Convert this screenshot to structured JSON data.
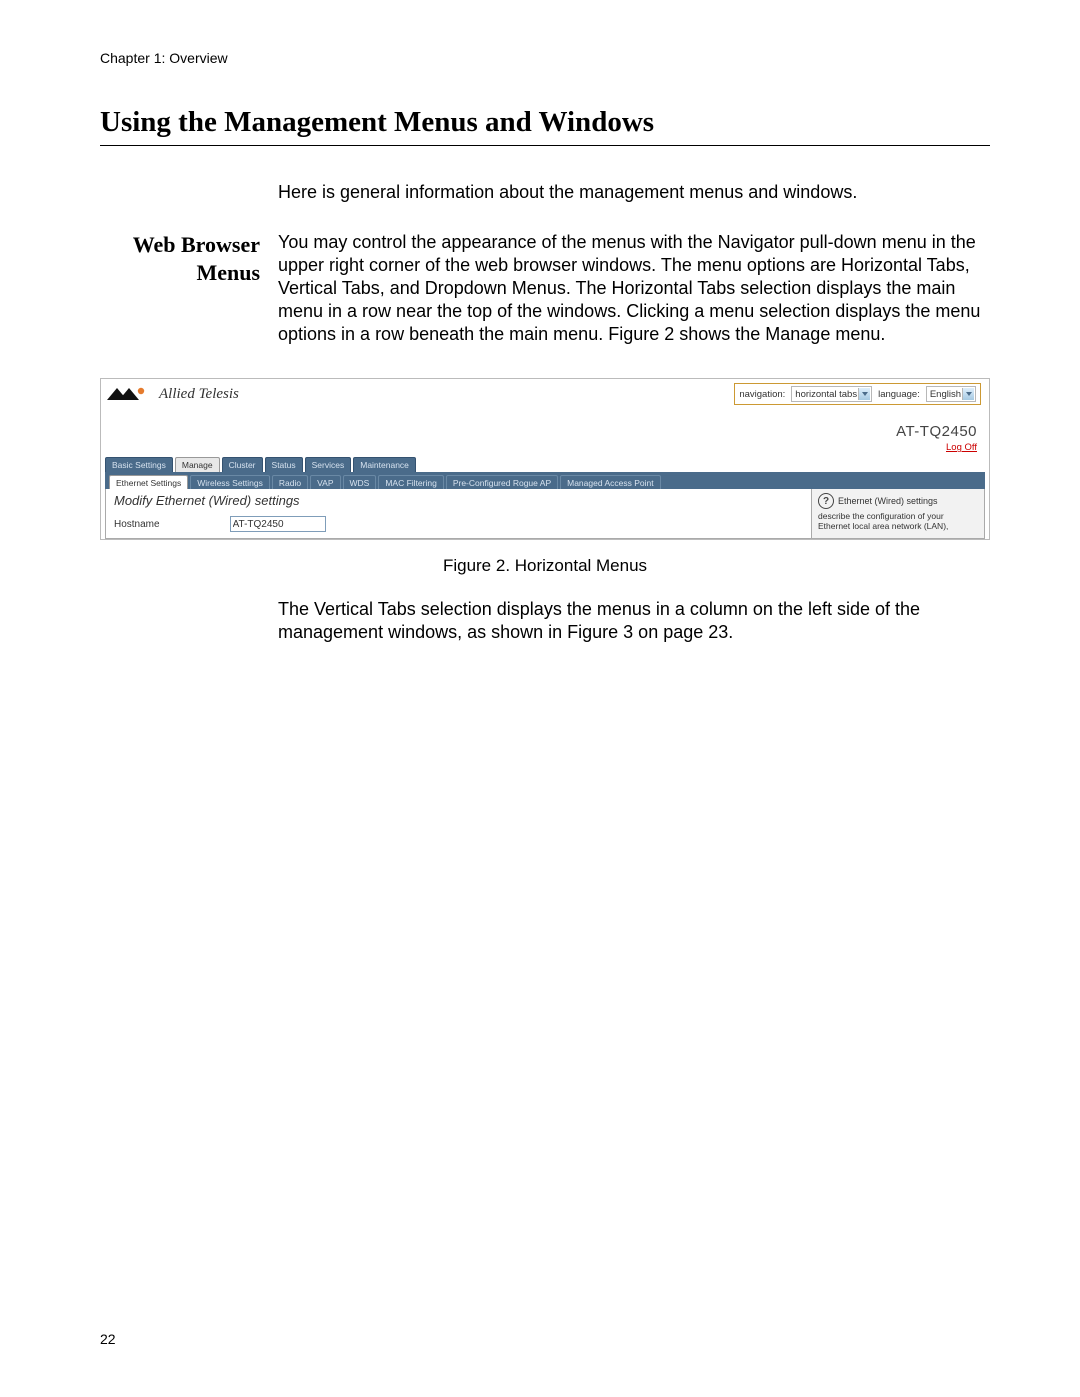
{
  "chapter": "Chapter 1: Overview",
  "section_title": "Using the Management Menus and Windows",
  "intro": "Here is general information about the management menus and windows.",
  "subheading_line1": "Web Browser",
  "subheading_line2": "Menus",
  "body1": "You may control the appearance of the menus with the Navigator pull-down menu in the upper right corner of the web browser windows. The menu options are Horizontal Tabs, Vertical Tabs, and Dropdown Menus. The Horizontal Tabs selection displays the main menu in a row near the top of the windows. Clicking a menu selection displays the menu options in a row beneath the main menu. Figure 2 shows the Manage menu.",
  "figure_caption": "Figure 2. Horizontal Menus",
  "body2": "The Vertical Tabs selection displays the menus in a column on the left side of the management windows, as shown in Figure 3 on page 23.",
  "page_number": "22",
  "screenshot": {
    "logo_text": "Allied Telesis",
    "nav_label": "navigation:",
    "nav_value": "horizontal tabs",
    "lang_label": "language:",
    "lang_value": "English",
    "model": "AT-TQ2450",
    "logoff": "Log Off",
    "main_tabs": [
      "Basic Settings",
      "Manage",
      "Cluster",
      "Status",
      "Services",
      "Maintenance"
    ],
    "main_active_index": 1,
    "sub_tabs": [
      "Ethernet Settings",
      "Wireless Settings",
      "Radio",
      "VAP",
      "WDS",
      "MAC Filtering",
      "Pre-Configured Rogue AP",
      "Managed Access Point"
    ],
    "sub_active_index": 0,
    "panel_title": "Modify Ethernet (Wired) settings",
    "field_label": "Hostname",
    "field_value": "AT-TQ2450",
    "help_title": "Ethernet (Wired) settings",
    "help_text": "describe the configuration of your Ethernet local area network (LAN),"
  }
}
